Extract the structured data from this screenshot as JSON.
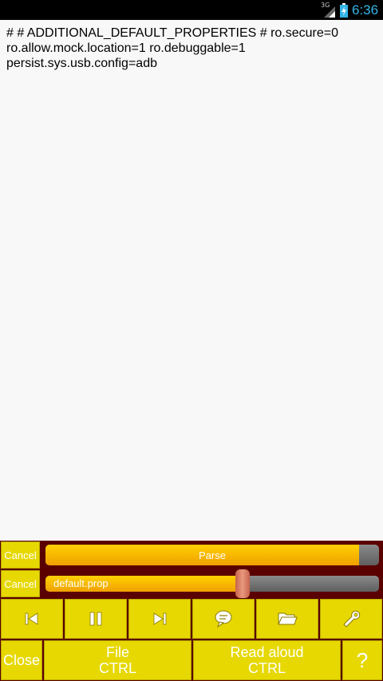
{
  "status_bar": {
    "network": "3G",
    "time": "6:36",
    "time_color": "#33b5e5"
  },
  "document": {
    "text": "# # ADDITIONAL_DEFAULT_PROPERTIES # ro.secure=0 ro.allow.mock.location=1 ro.debuggable=1 persist.sys.usb.config=adb"
  },
  "controls": {
    "cancel_top_label": "Cancel",
    "parse_label": "Parse",
    "parse_progress_percent": 94,
    "cancel_bottom_label": "Cancel",
    "file_name": "default.prop",
    "seek_position_percent": 59,
    "media_icons": [
      "skip-previous-icon",
      "pause-icon",
      "skip-next-icon",
      "speech-bubble-icon",
      "folder-open-icon",
      "wrench-icon"
    ],
    "close_label": "Close",
    "file_label": "File",
    "file_sub": "CTRL",
    "read_aloud_label": "Read aloud",
    "read_aloud_sub": "CTRL",
    "help_label": "?"
  },
  "colors": {
    "panel_bg": "#5a0000",
    "button_bg": "#e6d800",
    "progress_fill": "#f0a000"
  }
}
